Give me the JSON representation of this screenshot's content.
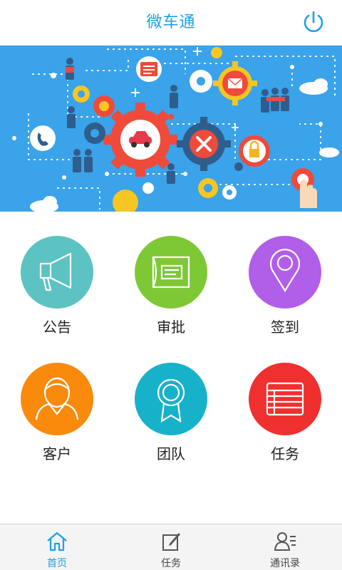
{
  "header": {
    "title": "微车通",
    "power_icon": "power-icon",
    "accent": "#1e9fe3"
  },
  "banner": {
    "image": "business-gears-illustration",
    "background": "#3aa3ea"
  },
  "grid": [
    {
      "label": "公告",
      "icon": "megaphone-icon",
      "color": "#5cc3c2"
    },
    {
      "label": "审批",
      "icon": "approval-document-icon",
      "color": "#7ec835"
    },
    {
      "label": "签到",
      "icon": "location-pin-icon",
      "color": "#b15ee8"
    },
    {
      "label": "客户",
      "icon": "customer-person-icon",
      "color": "#f98a0c"
    },
    {
      "label": "团队",
      "icon": "team-badge-icon",
      "color": "#17b2c9"
    },
    {
      "label": "任务",
      "icon": "task-list-icon",
      "color": "#f0302f"
    }
  ],
  "tabs": [
    {
      "label": "首页",
      "icon": "home-icon",
      "active": true
    },
    {
      "label": "任务",
      "icon": "edit-task-icon",
      "active": false
    },
    {
      "label": "通讯录",
      "icon": "contacts-icon",
      "active": false
    }
  ]
}
